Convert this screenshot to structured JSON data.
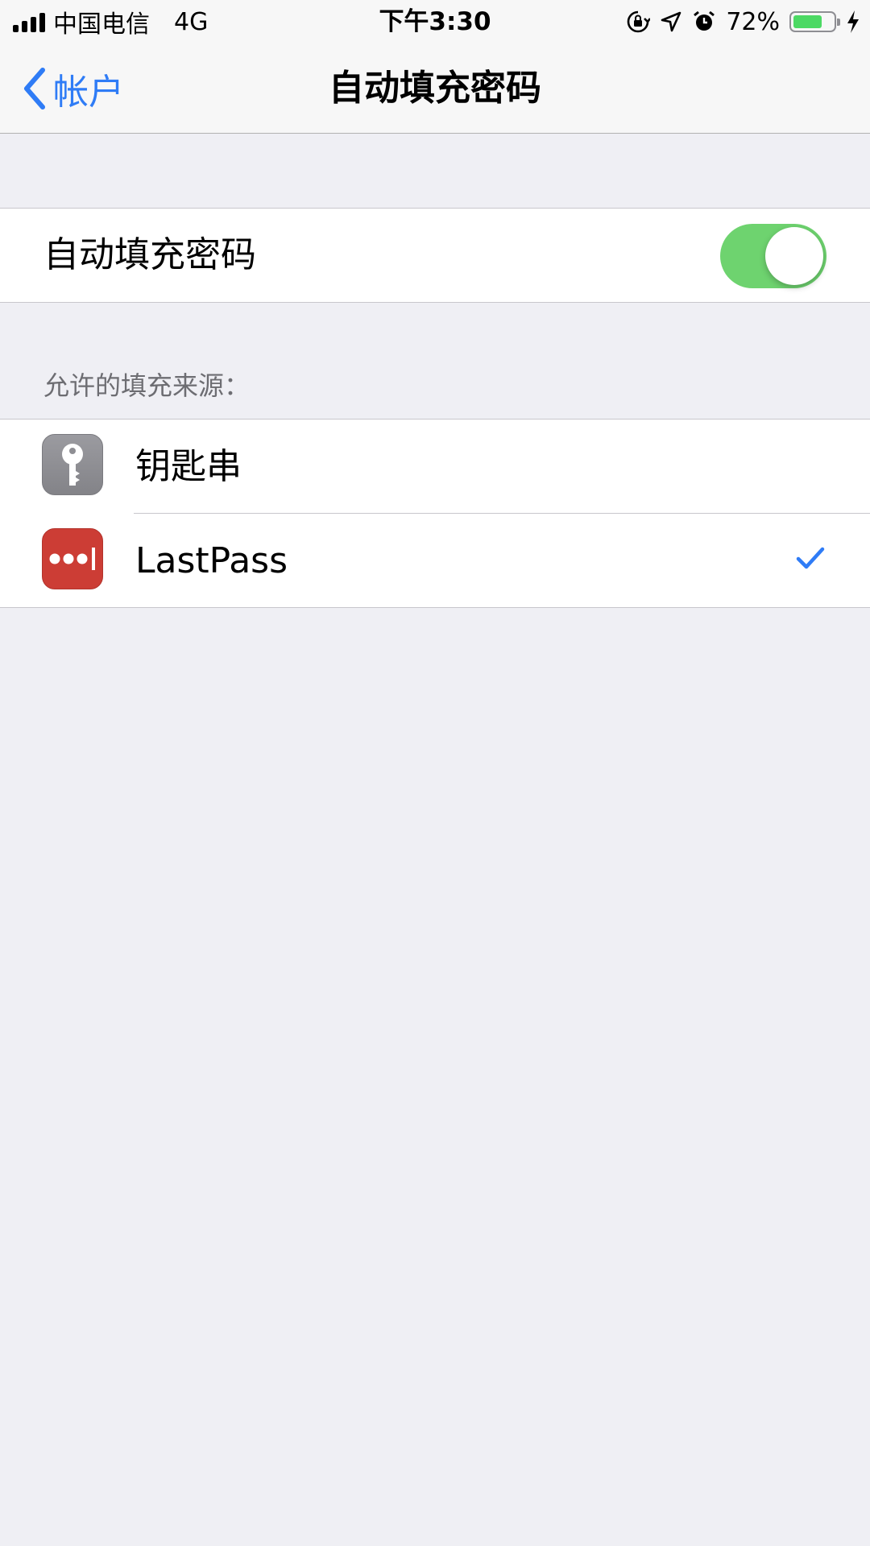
{
  "status_bar": {
    "carrier": "中国电信",
    "network": "4G",
    "time": "下午3:30",
    "battery_percent": "72%",
    "battery_level": 0.72,
    "icons": [
      "signal-icon",
      "rotation-lock-icon",
      "location-icon",
      "alarm-icon",
      "battery-icon",
      "charging-icon"
    ]
  },
  "nav": {
    "back_label": "帐户",
    "title": "自动填充密码"
  },
  "autofill": {
    "label": "自动填充密码",
    "enabled": true
  },
  "sources": {
    "header": "允许的填充来源：",
    "items": [
      {
        "label": "钥匙串",
        "icon": "keychain-icon",
        "selected": false
      },
      {
        "label": "LastPass",
        "icon": "lastpass-icon",
        "selected": true
      }
    ]
  },
  "colors": {
    "accent": "#2f7cf6",
    "switch_on": "#6ed36f",
    "battery": "#4cd964",
    "lastpass_red": "#cc3d35",
    "keychain_gray": "#8e8e93",
    "background": "#efeff4"
  }
}
